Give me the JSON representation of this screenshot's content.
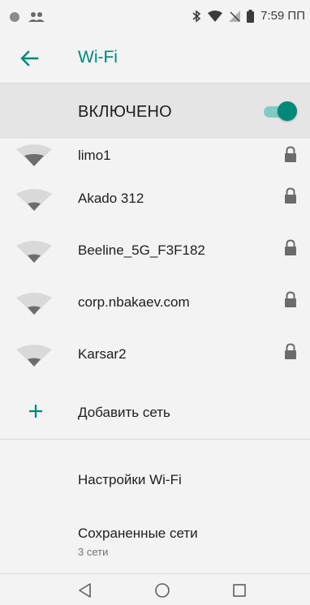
{
  "status_bar": {
    "time": "7:59 ПП",
    "left_icons": [
      "status-dot-icon",
      "people-icon"
    ],
    "right_icons": [
      "bluetooth-icon",
      "wifi-signal-icon",
      "no-signal-icon",
      "battery-icon"
    ]
  },
  "app_bar": {
    "title": "Wi-Fi",
    "back_icon": "arrow-back-icon"
  },
  "master_switch": {
    "label": "ВКЛЮЧЕНО",
    "state": "on"
  },
  "networks": [
    {
      "name": "limo1",
      "secured": true
    },
    {
      "name": "Akado 312",
      "secured": true
    },
    {
      "name": "Beeline_5G_F3F182",
      "secured": true
    },
    {
      "name": "corp.nbakaev.com",
      "secured": true
    },
    {
      "name": "Karsar2",
      "secured": true
    }
  ],
  "add_network": {
    "label": "Добавить сеть"
  },
  "settings": {
    "wifi_settings_label": "Настройки Wi-Fi",
    "saved_networks_label": "Сохраненные сети",
    "saved_networks_count": "3 сети"
  },
  "colors": {
    "accent": "#00897b",
    "accent_light": "#80cbc4",
    "wifi_icon": "#a5a5a5"
  }
}
